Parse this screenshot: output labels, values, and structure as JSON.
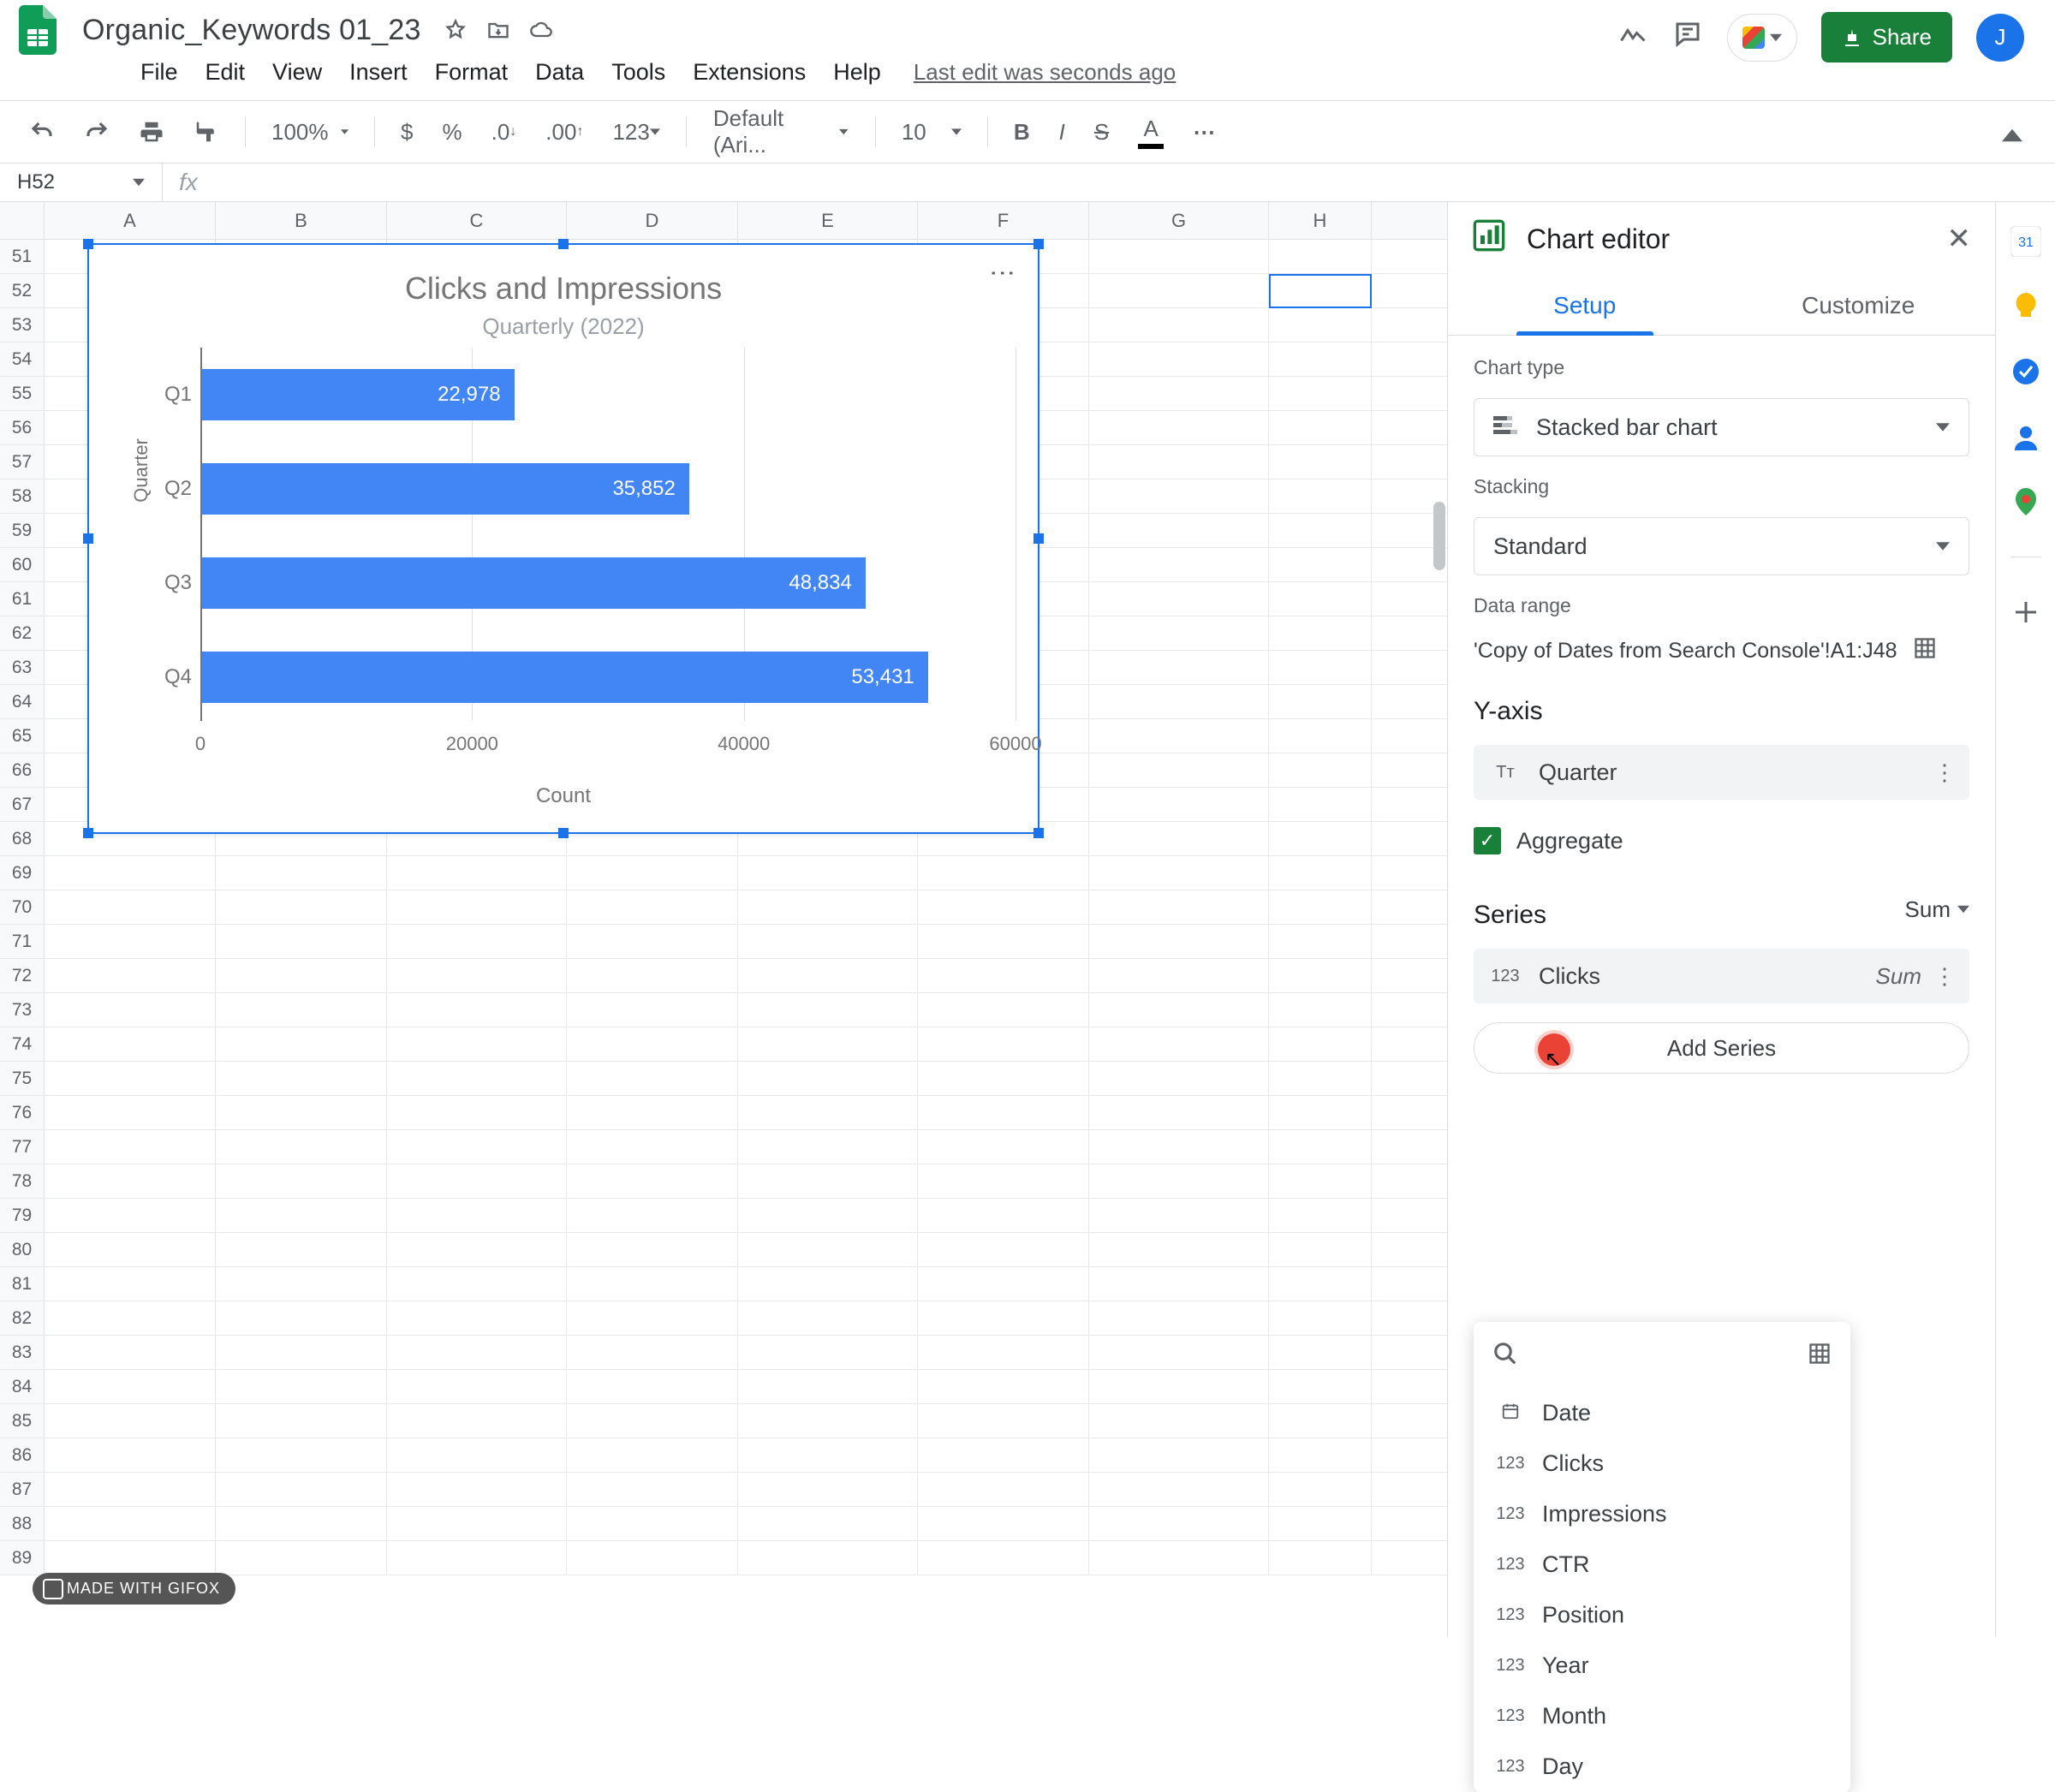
{
  "doc": {
    "title": "Organic_Keywords 01_23"
  },
  "menu": {
    "items": [
      "File",
      "Edit",
      "View",
      "Insert",
      "Format",
      "Data",
      "Tools",
      "Extensions",
      "Help"
    ],
    "last_edit": "Last edit was seconds ago"
  },
  "toolbar": {
    "zoom": "100%",
    "font": "Default (Ari...",
    "font_size": "10",
    "number_format": "123"
  },
  "share": {
    "label": "Share"
  },
  "avatar_initial": "J",
  "cell_ref": "H52",
  "columns": [
    "A",
    "B",
    "C",
    "D",
    "E",
    "F",
    "G",
    "H"
  ],
  "row_start": 51,
  "row_end": 89,
  "chart_editor": {
    "title": "Chart editor",
    "tabs": {
      "setup": "Setup",
      "customize": "Customize"
    },
    "chart_type_label": "Chart type",
    "chart_type_value": "Stacked bar chart",
    "stacking_label": "Stacking",
    "stacking_value": "Standard",
    "data_range_label": "Data range",
    "data_range_value": "'Copy of Dates from Search Console'!A1:J48",
    "yaxis_label": "Y-axis",
    "yaxis_value": "Quarter",
    "aggregate_label": "Aggregate",
    "series_label": "Series",
    "series_agg": "Sum",
    "series_item": "Clicks",
    "series_item_agg": "Sum",
    "add_series_label": "Add Series",
    "popup_items": [
      {
        "type": "date",
        "label": "Date"
      },
      {
        "type": "123",
        "label": "Clicks"
      },
      {
        "type": "123",
        "label": "Impressions"
      },
      {
        "type": "123",
        "label": "CTR"
      },
      {
        "type": "123",
        "label": "Position"
      },
      {
        "type": "123",
        "label": "Year"
      },
      {
        "type": "123",
        "label": "Month"
      },
      {
        "type": "123",
        "label": "Day"
      }
    ]
  },
  "chart_data": {
    "type": "bar",
    "orientation": "horizontal",
    "title": "Clicks and Impressions",
    "subtitle": "Quarterly (2022)",
    "ylabel": "Quarter",
    "xlabel": "Count",
    "categories": [
      "Q1",
      "Q2",
      "Q3",
      "Q4"
    ],
    "values": [
      22978,
      35852,
      48834,
      53431
    ],
    "value_labels": [
      "22,978",
      "35,852",
      "48,834",
      "53,431"
    ],
    "xlim": [
      0,
      60000
    ],
    "xticks": [
      0,
      20000,
      40000,
      60000
    ],
    "xtick_labels": [
      "0",
      "20000",
      "40000",
      "60000"
    ],
    "series_color": "#4285f4"
  },
  "gifox": "MADE WITH GIFOX"
}
